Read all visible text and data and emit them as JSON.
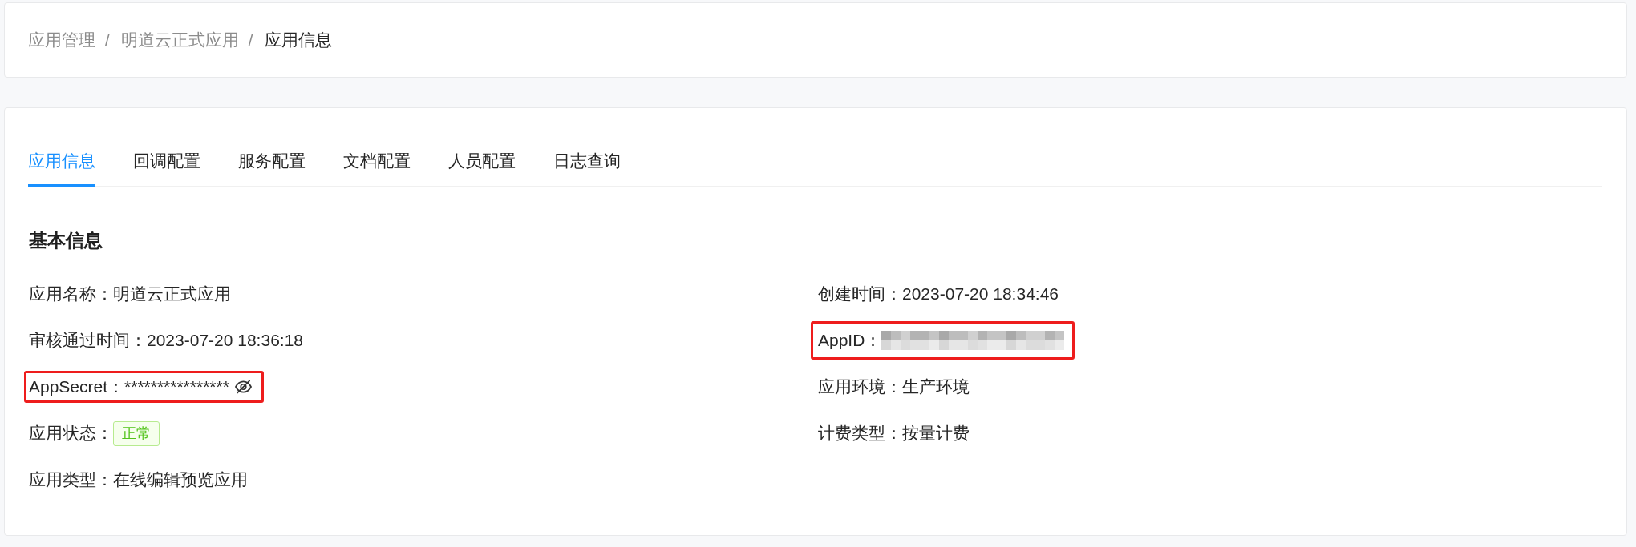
{
  "breadcrumb": [
    {
      "label": "应用管理",
      "current": false
    },
    {
      "separator": "/",
      "label": "明道云正式应用",
      "current": false
    },
    {
      "separator": "/",
      "label": "应用信息",
      "current": true
    }
  ],
  "tabs": [
    {
      "label": "应用信息",
      "selected": true
    },
    {
      "label": "回调配置",
      "selected": false
    },
    {
      "label": "服务配置",
      "selected": false
    },
    {
      "label": "文档配置",
      "selected": false
    },
    {
      "label": "人员配置",
      "selected": false
    },
    {
      "label": "日志查询",
      "selected": false
    }
  ],
  "basic_info": {
    "title": "基本信息",
    "left_fields": [
      {
        "kind": "text",
        "label": "应用名称：",
        "value": "明道云正式应用",
        "highlighted": false
      },
      {
        "kind": "text",
        "label": "审核通过时间：",
        "value": "2023-07-20 18:36:18",
        "highlighted": false
      },
      {
        "kind": "secret",
        "label": "AppSecret：",
        "value": "****************",
        "revealed": false,
        "highlighted": true
      },
      {
        "kind": "tag",
        "label": "应用状态：",
        "value": "正常",
        "highlighted": false
      },
      {
        "kind": "text",
        "label": "应用类型：",
        "value": "在线编辑预览应用",
        "highlighted": false
      }
    ],
    "right_fields": [
      {
        "kind": "text",
        "label": "创建时间：",
        "value": "2023-07-20 18:34:46",
        "highlighted": false
      },
      {
        "kind": "redacted",
        "label": "AppID：",
        "highlighted": true
      },
      {
        "kind": "text",
        "label": "应用环境：",
        "value": "生产环境",
        "highlighted": false
      },
      {
        "kind": "text",
        "label": "计费类型：",
        "value": "按量计费",
        "highlighted": false
      }
    ]
  }
}
